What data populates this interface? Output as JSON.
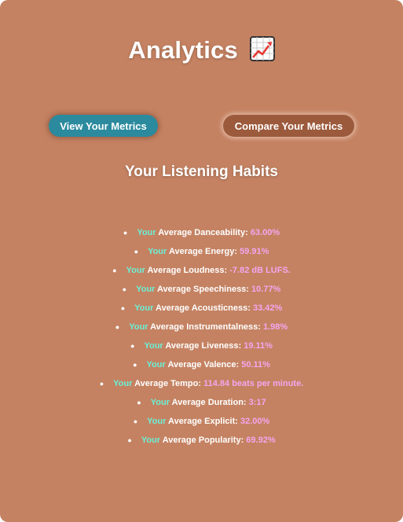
{
  "header": {
    "title": "Analytics",
    "icon": "chart-increasing-icon"
  },
  "buttons": {
    "view_label": "View Your Metrics",
    "compare_label": "Compare Your Metrics"
  },
  "section": {
    "title": "Your Listening Habits"
  },
  "metrics": [
    {
      "your": "Your",
      "label": "Average Danceability:",
      "value": "63.00%"
    },
    {
      "your": "Your",
      "label": "Average Energy:",
      "value": "59.91%"
    },
    {
      "your": "Your",
      "label": "Average Loudness:",
      "value": "-7.82 dB LUFS."
    },
    {
      "your": "Your",
      "label": "Average Speechiness:",
      "value": "10.77%"
    },
    {
      "your": "Your",
      "label": "Average Acousticness:",
      "value": "33.42%"
    },
    {
      "your": "Your",
      "label": "Average Instrumentalness:",
      "value": "1.98%"
    },
    {
      "your": "Your",
      "label": "Average Liveness:",
      "value": "19.11%"
    },
    {
      "your": "Your",
      "label": "Average Valence:",
      "value": "50.11%"
    },
    {
      "your": "Your",
      "label": "Average Tempo:",
      "value": "114.84 beats per minute."
    },
    {
      "your": "Your",
      "label": "Average Duration:",
      "value": "3:17"
    },
    {
      "your": "Your",
      "label": "Average Explicit:",
      "value": "32.00%"
    },
    {
      "your": "Your",
      "label": "Average Popularity:",
      "value": "69.92%"
    }
  ],
  "colors": {
    "background": "#c48262",
    "view_button": "#2b8a9e",
    "compare_button": "#9c5a3c",
    "your_highlight": "#6cf0d6",
    "value_highlight": "#f3a6ee"
  }
}
